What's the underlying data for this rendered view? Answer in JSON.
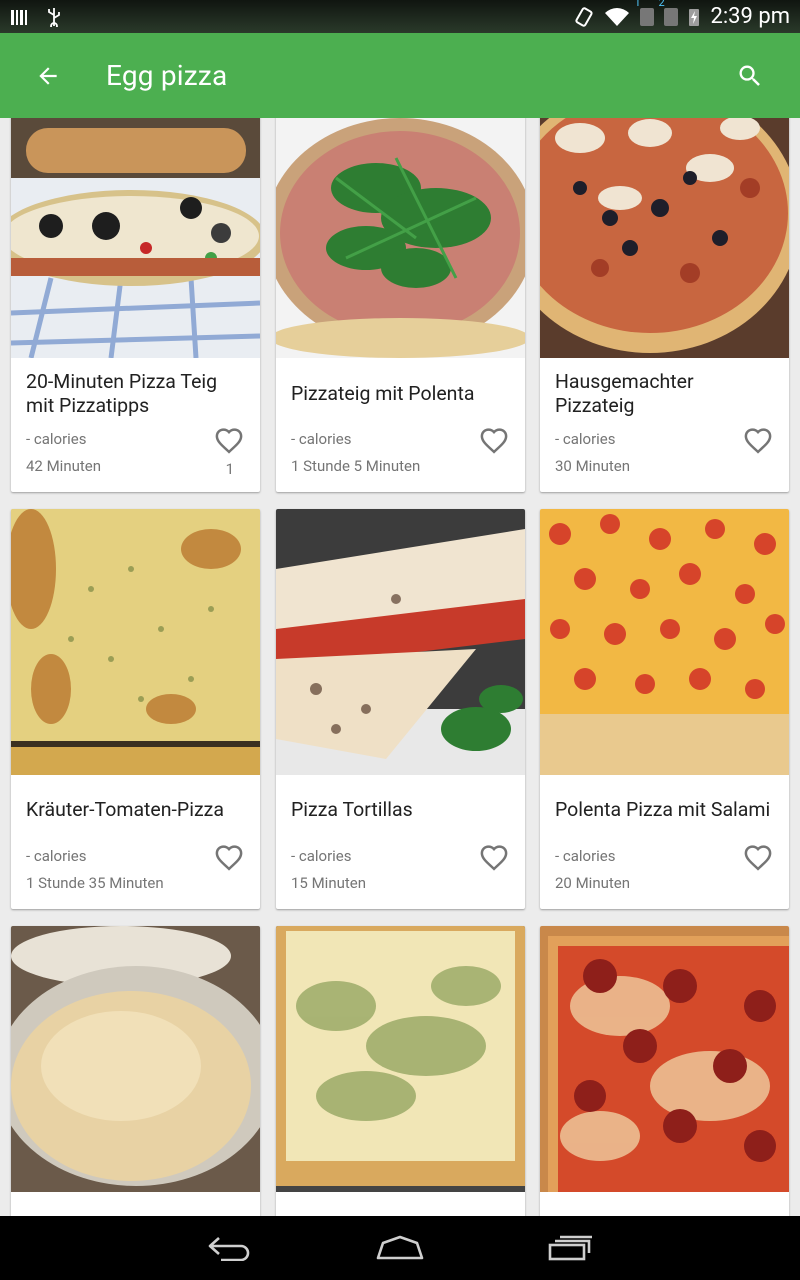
{
  "status": {
    "time": "2:39 pm",
    "sim1": "1",
    "sim2": "2"
  },
  "appbar": {
    "title": "Egg pizza",
    "back_icon": "arrow-back-icon",
    "search_icon": "search-icon"
  },
  "recipes": [
    {
      "name": "20-Minuten Pizza Teig mit Pizzatipps",
      "calories": "- calories",
      "time": "42 Minuten",
      "favorites": "1",
      "image": "pizza-olives-rolling-pin"
    },
    {
      "name": "Pizzateig mit Polenta",
      "calories": "- calories",
      "time": "1 Stunde 5 Minuten",
      "favorites": "",
      "image": "pizza-arugula-prosciutto"
    },
    {
      "name": "Hausgemachter Pizzateig",
      "calories": "- calories",
      "time": "30 Minuten",
      "favorites": "",
      "image": "pizza-mushroom-olive"
    },
    {
      "name": "Kräuter-Tomaten-Pizza",
      "calories": "- calories",
      "time": "1 Stunde 35 Minuten",
      "favorites": "",
      "image": "herb-cheese-pizza"
    },
    {
      "name": "Pizza Tortillas",
      "calories": "- calories",
      "time": "15 Minuten",
      "favorites": "",
      "image": "quesadilla-tortillas"
    },
    {
      "name": "Polenta Pizza mit Salami",
      "calories": "- calories",
      "time": "20 Minuten",
      "favorites": "",
      "image": "pepperoni-pizza"
    },
    {
      "name": "",
      "calories": "",
      "time": "",
      "favorites": "",
      "image": "dough-in-bowl"
    },
    {
      "name": "",
      "calories": "",
      "time": "",
      "favorites": "",
      "image": "white-spinach-pizza"
    },
    {
      "name": "",
      "calories": "",
      "time": "",
      "favorites": "",
      "image": "pepperoni-square-pizza"
    }
  ],
  "nav": {
    "back_icon": "nav-back-icon",
    "home_icon": "nav-home-icon",
    "recents_icon": "nav-recents-icon"
  }
}
